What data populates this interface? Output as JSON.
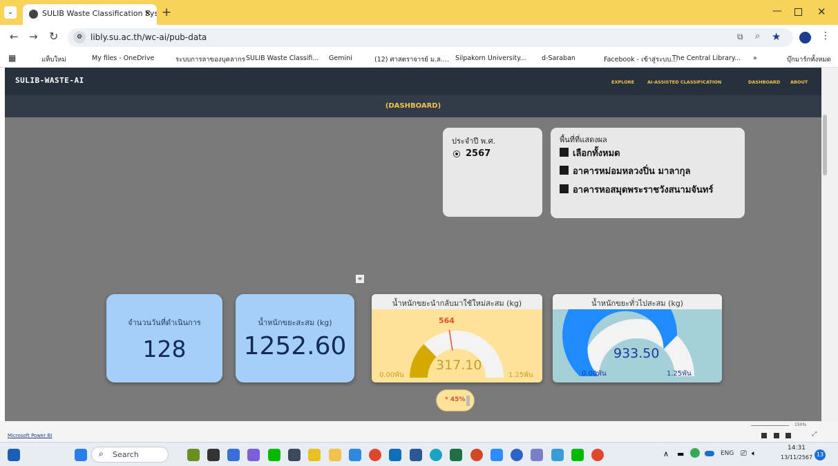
{
  "browser": {
    "tab_title": "SULIB Waste Classification Syste",
    "url": "libly.su.ac.th/wc-ai/pub-data",
    "bookmarks": [
      "แท็บใหม่",
      "My files - OneDrive",
      "ระบบการลาของบุคลากร",
      "SULIB Waste Classifi...",
      "Gemini",
      "(12) ศาสตราจารย์ ม.ล....",
      "Silpakorn University...",
      "d-Saraban",
      "Facebook - เข้าสู่ระบบ...",
      "The Central Library..."
    ],
    "all_bookmarks": "บุ๊กมาร์กทั้งหมด",
    "overflow": "»"
  },
  "app": {
    "brand": "SULIB-WASTE-AI",
    "nav": [
      "EXPLORE",
      "AI-ASSISTED CLASSIFICATION",
      "DASHBOARD",
      "ABOUT"
    ],
    "subtitle": "(DASHBOARD)"
  },
  "filters": {
    "year_title": "ประจำปี พ.ศ.",
    "year_value": "2567",
    "area_title": "พื้นที่ที่แสดงผล",
    "areas": [
      "เลือกทั้งหมด",
      "อาคารหม่อมหลวงปิ่น มาลากุล",
      "อาคารหอสมุดพระราชวังสนามจันทร์"
    ]
  },
  "kpis": {
    "days_label": "จำนวนวันที่ดำเนินการ",
    "days_value": "128",
    "total_label": "น้ำหนักขยะสะสม (kg)",
    "total_value": "1252.60"
  },
  "gauge_recycle": {
    "title": "น้ำหนักขยะนำกลับมาใช้ใหม่สะสม (kg)",
    "value": 317.1,
    "value_text": "317.10",
    "target_text": "564",
    "target": 564,
    "min_text": "0.00พัน",
    "max_text": "1.25พัน",
    "max": 1250,
    "fill_color": "#d4aa00"
  },
  "gauge_general": {
    "title": "น้ำหนักขยะทั่วไปสะสม (kg)",
    "value": 933.5,
    "value_text": "933.50",
    "min_text": "0.00พัน",
    "max_text": "1.25พัน",
    "max": 1250,
    "fill_color": "#1e8cff"
  },
  "pill": "* 45%",
  "powerbi": {
    "link": "Microsoft Power BI",
    "zoom": "150%"
  },
  "taskbar": {
    "search": "Search",
    "lang": "ENG",
    "time": "14:31",
    "date": "13/11/2567",
    "badge": "13"
  }
}
